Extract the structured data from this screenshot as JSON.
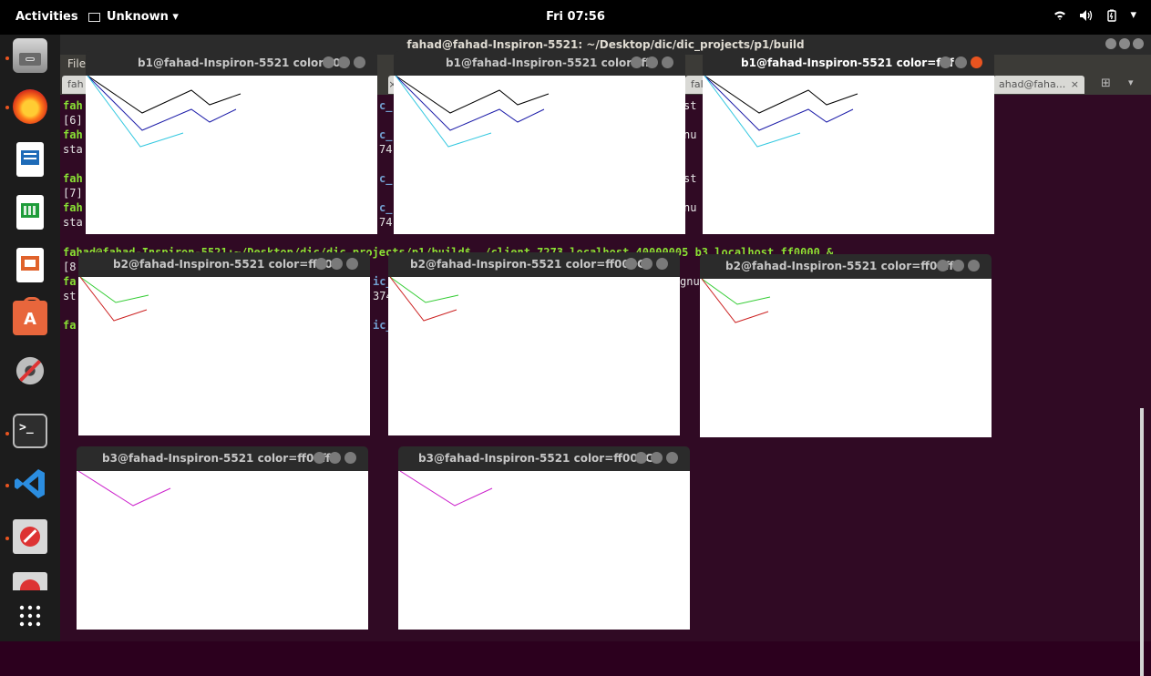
{
  "topbar": {
    "activities": "Activities",
    "app_menu": "Unknown ▾",
    "clock": "Fri 07:56",
    "tray": [
      "wifi-icon",
      "volume-icon",
      "battery-icon",
      "▾"
    ]
  },
  "dock": {
    "items": [
      "files-icon",
      "firefox-icon",
      "writer-icon",
      "calc-icon",
      "impress-icon",
      "software-center-icon",
      "settings-icon",
      "terminal-icon",
      "vscode-icon",
      "blocked-app-icon",
      "blocked-app-icon-2"
    ],
    "show_apps": "⋮⋮⋮"
  },
  "terminal": {
    "title": "fahad@fahad-Inspiron-5521: ~/Desktop/dic/dic_projects/p1/build",
    "menu_file": "File",
    "tabs": [
      "fah",
      "fal",
      "ahad@faha..."
    ],
    "lines": [
      {
        "left": "fah",
        "mid": "c_",
        "right": "st"
      },
      {
        "left": "[6]",
        "mid": "",
        "right": ""
      },
      {
        "left": "fah",
        "mid": "c_",
        "right": "nu"
      },
      {
        "left": "sta",
        "mid": "74",
        "right": ""
      },
      {
        "left": "fah",
        "mid": "c_",
        "right": "st"
      },
      {
        "left": "[7]",
        "mid": "",
        "right": ""
      },
      {
        "left": "fah",
        "mid": "c_",
        "right": "nu"
      },
      {
        "left": "sta",
        "mid": "74",
        "right": ""
      },
      {
        "left": "fahad@fahad-Inspiron-5521:~/Desktop/dic/dic_projects/p1/build$ ./client 7273 localhost 40000005 b3 localhost ff0000 &",
        "mid": "",
        "right": ""
      },
      {
        "left": "[8",
        "mid": "",
        "right": ""
      },
      {
        "left": "fa",
        "mid": "ic_",
        "right": "gnu"
      },
      {
        "left": "st",
        "mid": "374",
        "right": ""
      },
      {
        "left": "fa",
        "mid": "ic_",
        "right": ""
      }
    ]
  },
  "windows": [
    {
      "title": "b1@fahad-Inspiron-5521 color=0",
      "focused": false
    },
    {
      "title": "b1@fahad-Inspiron-5521 color=ff",
      "focused": false
    },
    {
      "title": "b1@fahad-Inspiron-5521 color=ffff",
      "focused": true
    },
    {
      "title": "b2@fahad-Inspiron-5521 color=ff00",
      "focused": false
    },
    {
      "title": "b2@fahad-Inspiron-5521 color=ff000C",
      "focused": false
    },
    {
      "title": "b2@fahad-Inspiron-5521 color=ff00ff",
      "focused": false
    },
    {
      "title": "b3@fahad-Inspiron-5521 color=ff00ff",
      "focused": false
    },
    {
      "title": "b3@fahad-Inspiron-5521 color=ff000C",
      "focused": false
    }
  ],
  "colors": {
    "ubuntu_orange": "#e95420",
    "terminal_bg": "#300a24",
    "line_black": "#000000",
    "line_blue": "#1a1aa8",
    "line_cyan": "#33c8e0",
    "line_green": "#33cc33",
    "line_red": "#cc2222",
    "line_magenta": "#cc22cc"
  }
}
